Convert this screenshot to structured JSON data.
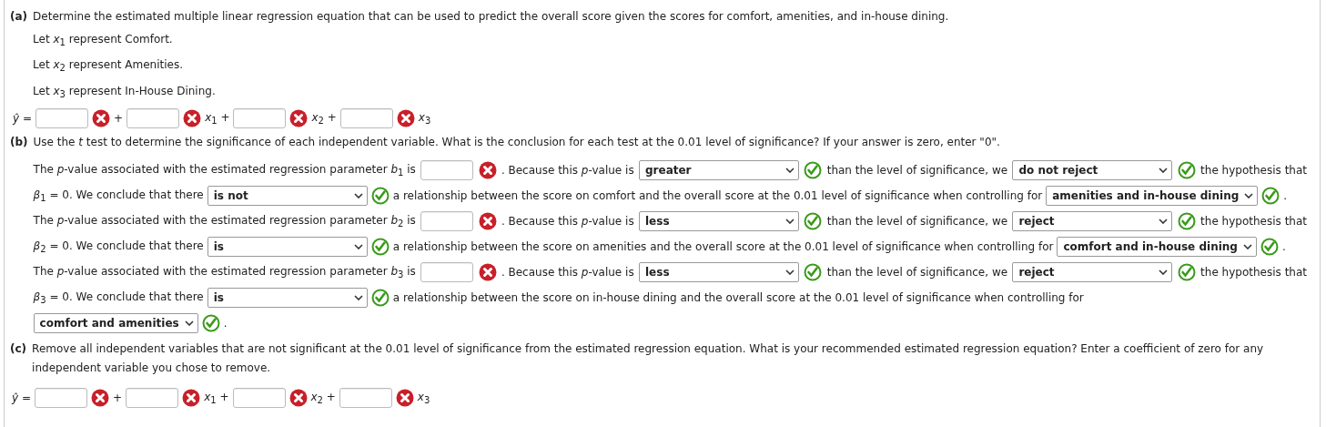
{
  "part_a": {
    "label": "(a)",
    "question": "Determine the estimated multiple linear regression equation that can be used to predict the overall score given the scores for comfort, amenities, and in-house dining.",
    "definitions": [
      "Let *x*$_{1}$ represent Comfort.",
      "Let *x*$_{2}$ represent Amenities.",
      "Let *x*$_{3}$ represent In-House Dining."
    ],
    "equation": {
      "lhs": "ŷ =",
      "terms": [
        {
          "correct": false,
          "after": "+"
        },
        {
          "correct": false,
          "after": "*x*$_{1}$ +"
        },
        {
          "correct": false,
          "after": "*x*$_{2}$ +"
        },
        {
          "correct": false,
          "after": "*x*$_{3}$"
        }
      ]
    }
  },
  "part_b": {
    "label": "(b)",
    "question": "Use the *t* test to determine the significance of each independent variable. What is the conclusion for each test at the 0.01 level of significance? If your answer is zero, enter \"0\".",
    "lines": [
      [
        {
          "kind": "text",
          "text": "The *p*-value associated with the estimated regression parameter *b*$_{1}$ is"
        },
        {
          "kind": "input",
          "correct": false
        },
        {
          "kind": "text",
          "text": ". Because this *p*-value is"
        },
        {
          "kind": "select",
          "value": "greater",
          "correct": true
        },
        {
          "kind": "text",
          "text": "than the level of significance, we"
        },
        {
          "kind": "select",
          "value": "do not reject",
          "correct": true
        },
        {
          "kind": "text",
          "text": "the hypothesis that"
        }
      ],
      [
        {
          "kind": "text",
          "text": "*β*$_{1}$ = 0. We conclude that there"
        },
        {
          "kind": "select",
          "value": "is not",
          "correct": true
        },
        {
          "kind": "text",
          "text": "a relationship between the score on comfort and the overall score at the 0.01 level of significance when controlling for"
        },
        {
          "kind": "select",
          "value": "amenities and in-house dining",
          "correct": true
        },
        {
          "kind": "text",
          "text": "."
        }
      ],
      [
        {
          "kind": "text",
          "text": "The *p*-value associated with the estimated regression parameter *b*$_{2}$ is"
        },
        {
          "kind": "input",
          "correct": false
        },
        {
          "kind": "text",
          "text": ". Because this *p*-value is"
        },
        {
          "kind": "select",
          "value": "less",
          "correct": true
        },
        {
          "kind": "text",
          "text": "than the level of significance, we"
        },
        {
          "kind": "select",
          "value": "reject",
          "correct": true
        },
        {
          "kind": "text",
          "text": "the hypothesis that"
        }
      ],
      [
        {
          "kind": "text",
          "text": "*β*$_{2}$ = 0. We conclude that there"
        },
        {
          "kind": "select",
          "value": "is",
          "correct": true
        },
        {
          "kind": "text",
          "text": "a relationship between the score on amenities and the overall score at the 0.01 level of significance when controlling for"
        },
        {
          "kind": "select",
          "value": "comfort and in-house dining",
          "correct": true
        },
        {
          "kind": "text",
          "text": "."
        }
      ],
      [
        {
          "kind": "text",
          "text": "The *p*-value associated with the estimated regression parameter *b*$_{3}$ is"
        },
        {
          "kind": "input",
          "correct": false
        },
        {
          "kind": "text",
          "text": ". Because this *p*-value is"
        },
        {
          "kind": "select",
          "value": "less",
          "correct": true
        },
        {
          "kind": "text",
          "text": "than the level of significance, we"
        },
        {
          "kind": "select",
          "value": "reject",
          "correct": true
        },
        {
          "kind": "text",
          "text": "the hypothesis that"
        }
      ],
      [
        {
          "kind": "text",
          "text": "*β*$_{3}$ = 0. We conclude that there"
        },
        {
          "kind": "select",
          "value": "is",
          "correct": true
        },
        {
          "kind": "text",
          "text": "a relationship between the score on in-house dining and the overall score at the 0.01 level of significance when controlling for"
        }
      ],
      [
        {
          "kind": "select",
          "value": "comfort and amenities",
          "correct": true
        },
        {
          "kind": "text",
          "text": "."
        }
      ]
    ]
  },
  "part_c": {
    "label": "(c)",
    "question": "Remove all independent variables that are not significant at the 0.01 level of significance from the estimated regression equation. What is your recommended estimated regression equation? Enter a coefficient of zero for any independent variable you chose to remove.",
    "equation": {
      "lhs": "ŷ =",
      "terms": [
        {
          "correct": false,
          "after": "+"
        },
        {
          "correct": false,
          "after": "*x*$_{1}$ +"
        },
        {
          "correct": false,
          "after": "*x*$_{2}$ +"
        },
        {
          "correct": false,
          "after": "*x*$_{3}$"
        }
      ]
    }
  }
}
